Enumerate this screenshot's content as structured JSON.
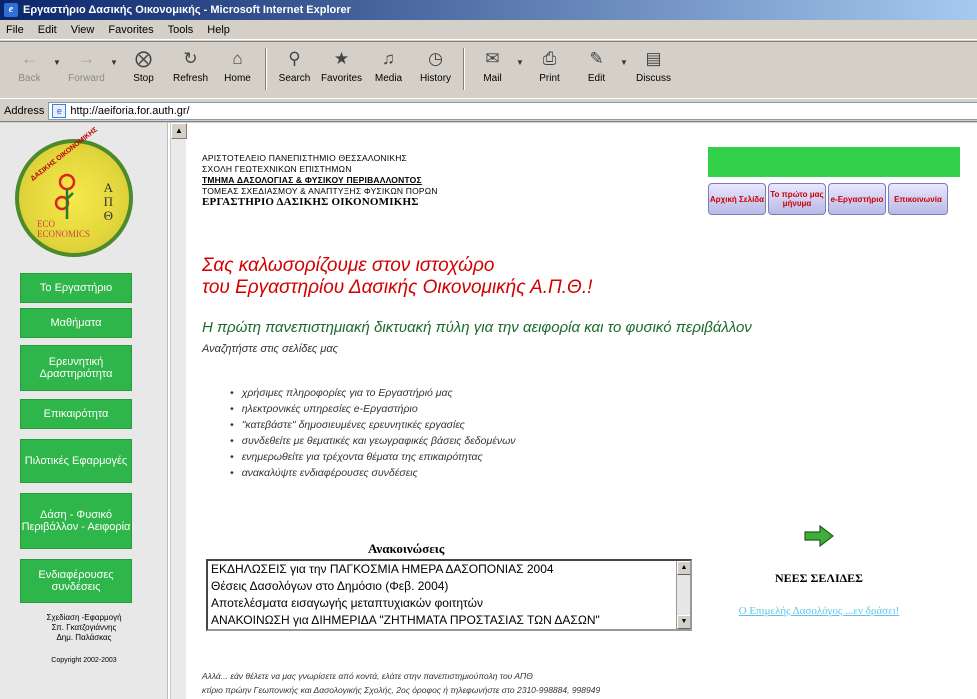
{
  "window": {
    "title": "Εργαστήριο Δασικής Οικονομικής - Microsoft Internet Explorer"
  },
  "menu": [
    "File",
    "Edit",
    "View",
    "Favorites",
    "Tools",
    "Help"
  ],
  "toolbar": {
    "back": "Back",
    "forward": "Forward",
    "stop": "Stop",
    "refresh": "Refresh",
    "home": "Home",
    "search": "Search",
    "favorites": "Favorites",
    "media": "Media",
    "history": "History",
    "mail": "Mail",
    "print": "Print",
    "edit": "Edit",
    "discuss": "Discuss"
  },
  "address": {
    "label": "Address",
    "url": "http://aeiforia.for.auth.gr/"
  },
  "logo": {
    "apth": "Α\nΠ\nΘ",
    "eco": "ECO\nECONOMICS"
  },
  "sidebar": {
    "items": [
      {
        "label": "Το Εργαστήριο"
      },
      {
        "label": "Μαθήματα"
      },
      {
        "label": "Ερευνητική Δραστηριότητα"
      },
      {
        "label": "Επικαιρότητα"
      },
      {
        "label": "Πιλοτικές Εφαρμογές"
      },
      {
        "label": "Δάση - Φυσικό Περιβάλλον - Αειφορία"
      },
      {
        "label": "Ενδιαφέρουσες συνδέσεις"
      }
    ],
    "credits": "Σχεδίαση -Εφαρμογή\nΣπ. Γκατζογιάννης\nΔημ. Παλάσκας",
    "copyright": "Copyright 2002-2003"
  },
  "header": {
    "line1": "ΑΡΙΣΤΟΤΕΛΕΙΟ ΠΑΝΕΠΙΣΤΗΜΙΟ ΘΕΣΣΑΛΟΝΙΚΗΣ",
    "line2": "ΣΧΟΛΗ ΓΕΩΤΕΧΝΙΚΩΝ ΕΠΙΣΤΗΜΩΝ",
    "line3": "ΤΜΗΜΑ ΔΑΣΟΛΟΓΙΑΣ & ΦΥΣΙΚΟΥ ΠΕΡΙΒΑΛΛΟΝΤΟΣ",
    "line4": "ΤΟΜΕΑΣ ΣΧΕΔΙΑΣΜΟΥ & ΑΝΑΠΤΥΞΗΣ ΦΥΣΙΚΩΝ ΠΟΡΩΝ",
    "line5": "ΕΡΓΑΣΤΗΡΙΟ ΔΑΣΙΚΗΣ ΟΙΚΟΝΟΜΙΚΗΣ"
  },
  "topnav": [
    {
      "label": "Αρχική Σελίδα"
    },
    {
      "label": "Το πρώτο μας μήνυμα"
    },
    {
      "label": "e-Εργαστήριο"
    },
    {
      "label": "Επικοινωνία"
    }
  ],
  "main": {
    "welcome1": "Σας καλωσορίζουμε στον ιστοχώρο",
    "welcome2": "του Εργαστηρίου Δασικής Οικονομικής Α.Π.Θ.!",
    "subtitle": "Η πρώτη πανεπιστημιακή δικτυακή πύλη για την αειφορία και το φυσικό περιβάλλον",
    "search_hint": "Αναζητήστε στις σελίδες μας",
    "bullets": [
      "χρήσιμες πληροφορίες για το Εργαστήριό μας",
      "ηλεκτρονικές υπηρεσίες e-Εργαστήριο",
      "\"κατεβάστε\" δημοσιευμένες ερευνητικές εργασίες",
      "συνδεθείτε με θεματικές και γεωγραφικές βάσεις δεδομένων",
      "ενημερωθείτε για τρέχοντα θέματα της επικαιρότητας",
      "ανακαλύψτε ενδιαφέρουσες συνδέσεις"
    ]
  },
  "announcements": {
    "title": "Ανακοινώσεις",
    "items": [
      "ΕΚΔΗΛΩΣΕΙΣ για την ΠΑΓΚΟΣΜΙΑ ΗΜΕΡΑ ΔΑΣΟΠΟΝΙΑΣ 2004",
      "Θέσεις Δασολόγων στο Δημόσιο (Φεβ. 2004)",
      "Αποτελέσματα εισαγωγής μεταπτυχιακών φοιτητών",
      "ΑΝΑΚΟΙΝΩΣΗ για ΔΙΗΜΕΡΙΔΑ \"ΖΗΤΗΜΑΤΑ ΠΡΟΣΤΑΣΙΑΣ ΤΩΝ ΔΑΣΩΝ\""
    ]
  },
  "new_pages": {
    "title": "ΝΕΕΣ ΣΕΛΙΔΕΣ",
    "link": "Ο Επιμελής Δασολόγος ...εν δράσει!"
  },
  "footer": {
    "line1": "Αλλά... εάν θέλετε να μας γνωρίσετε από κοντά, ελάτε στην πανεπιστημιούπολη του ΑΠΘ",
    "line2": "κτίριο πρώην Γεωπονικής και Δασολογικής Σχολής, 2ος όροφος ή τηλεφωνήστε στο 2310-998884, 998949"
  }
}
